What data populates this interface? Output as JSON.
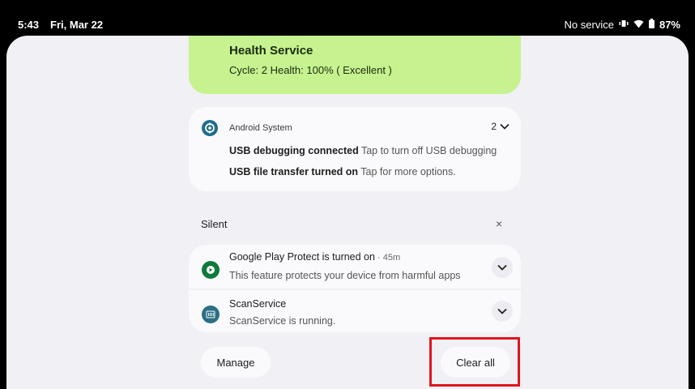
{
  "status_bar": {
    "time": "5:43",
    "date": "Fri, Mar 22",
    "network": "No service",
    "battery": "87%"
  },
  "health": {
    "title": "Health Service",
    "detail": "Cycle: 2  Health: 100%  ( Excellent )"
  },
  "android_system": {
    "app_name": "Android System",
    "count": "2",
    "lines": [
      {
        "title": "USB debugging connected",
        "text": "Tap to turn off USB debugging"
      },
      {
        "title": "USB file transfer turned on",
        "text": "Tap for more options."
      }
    ]
  },
  "silent": {
    "label": "Silent",
    "close_glyph": "×",
    "notifications": [
      {
        "title": "Google Play Protect is turned on",
        "time": " · 45m",
        "body": "This feature protects your device from harmful apps"
      },
      {
        "title": "ScanService",
        "time": "",
        "body": "ScanService is running."
      }
    ]
  },
  "actions": {
    "manage": "Manage",
    "clear_all": "Clear all"
  },
  "colors": {
    "health_card": "#c6f28f",
    "system_icon": "#1f6e8c",
    "play_protect_icon": "#0f7a3c",
    "scan_icon": "#2a6f86",
    "highlight": "#e0161b"
  }
}
